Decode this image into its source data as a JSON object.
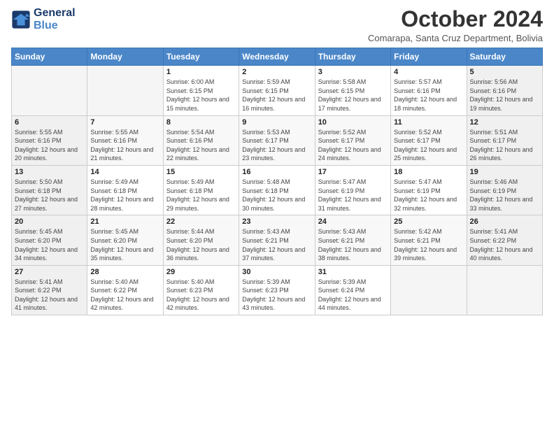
{
  "logo": {
    "line1": "General",
    "line2": "Blue"
  },
  "header": {
    "month": "October 2024",
    "subtitle": "Comarapa, Santa Cruz Department, Bolivia"
  },
  "weekdays": [
    "Sunday",
    "Monday",
    "Tuesday",
    "Wednesday",
    "Thursday",
    "Friday",
    "Saturday"
  ],
  "weeks": [
    [
      {
        "day": "",
        "info": ""
      },
      {
        "day": "",
        "info": ""
      },
      {
        "day": "1",
        "info": "Sunrise: 6:00 AM\nSunset: 6:15 PM\nDaylight: 12 hours and 15 minutes."
      },
      {
        "day": "2",
        "info": "Sunrise: 5:59 AM\nSunset: 6:15 PM\nDaylight: 12 hours and 16 minutes."
      },
      {
        "day": "3",
        "info": "Sunrise: 5:58 AM\nSunset: 6:15 PM\nDaylight: 12 hours and 17 minutes."
      },
      {
        "day": "4",
        "info": "Sunrise: 5:57 AM\nSunset: 6:16 PM\nDaylight: 12 hours and 18 minutes."
      },
      {
        "day": "5",
        "info": "Sunrise: 5:56 AM\nSunset: 6:16 PM\nDaylight: 12 hours and 19 minutes."
      }
    ],
    [
      {
        "day": "6",
        "info": "Sunrise: 5:55 AM\nSunset: 6:16 PM\nDaylight: 12 hours and 20 minutes."
      },
      {
        "day": "7",
        "info": "Sunrise: 5:55 AM\nSunset: 6:16 PM\nDaylight: 12 hours and 21 minutes."
      },
      {
        "day": "8",
        "info": "Sunrise: 5:54 AM\nSunset: 6:16 PM\nDaylight: 12 hours and 22 minutes."
      },
      {
        "day": "9",
        "info": "Sunrise: 5:53 AM\nSunset: 6:17 PM\nDaylight: 12 hours and 23 minutes."
      },
      {
        "day": "10",
        "info": "Sunrise: 5:52 AM\nSunset: 6:17 PM\nDaylight: 12 hours and 24 minutes."
      },
      {
        "day": "11",
        "info": "Sunrise: 5:52 AM\nSunset: 6:17 PM\nDaylight: 12 hours and 25 minutes."
      },
      {
        "day": "12",
        "info": "Sunrise: 5:51 AM\nSunset: 6:17 PM\nDaylight: 12 hours and 26 minutes."
      }
    ],
    [
      {
        "day": "13",
        "info": "Sunrise: 5:50 AM\nSunset: 6:18 PM\nDaylight: 12 hours and 27 minutes."
      },
      {
        "day": "14",
        "info": "Sunrise: 5:49 AM\nSunset: 6:18 PM\nDaylight: 12 hours and 28 minutes."
      },
      {
        "day": "15",
        "info": "Sunrise: 5:49 AM\nSunset: 6:18 PM\nDaylight: 12 hours and 29 minutes."
      },
      {
        "day": "16",
        "info": "Sunrise: 5:48 AM\nSunset: 6:18 PM\nDaylight: 12 hours and 30 minutes."
      },
      {
        "day": "17",
        "info": "Sunrise: 5:47 AM\nSunset: 6:19 PM\nDaylight: 12 hours and 31 minutes."
      },
      {
        "day": "18",
        "info": "Sunrise: 5:47 AM\nSunset: 6:19 PM\nDaylight: 12 hours and 32 minutes."
      },
      {
        "day": "19",
        "info": "Sunrise: 5:46 AM\nSunset: 6:19 PM\nDaylight: 12 hours and 33 minutes."
      }
    ],
    [
      {
        "day": "20",
        "info": "Sunrise: 5:45 AM\nSunset: 6:20 PM\nDaylight: 12 hours and 34 minutes."
      },
      {
        "day": "21",
        "info": "Sunrise: 5:45 AM\nSunset: 6:20 PM\nDaylight: 12 hours and 35 minutes."
      },
      {
        "day": "22",
        "info": "Sunrise: 5:44 AM\nSunset: 6:20 PM\nDaylight: 12 hours and 36 minutes."
      },
      {
        "day": "23",
        "info": "Sunrise: 5:43 AM\nSunset: 6:21 PM\nDaylight: 12 hours and 37 minutes."
      },
      {
        "day": "24",
        "info": "Sunrise: 5:43 AM\nSunset: 6:21 PM\nDaylight: 12 hours and 38 minutes."
      },
      {
        "day": "25",
        "info": "Sunrise: 5:42 AM\nSunset: 6:21 PM\nDaylight: 12 hours and 39 minutes."
      },
      {
        "day": "26",
        "info": "Sunrise: 5:41 AM\nSunset: 6:22 PM\nDaylight: 12 hours and 40 minutes."
      }
    ],
    [
      {
        "day": "27",
        "info": "Sunrise: 5:41 AM\nSunset: 6:22 PM\nDaylight: 12 hours and 41 minutes."
      },
      {
        "day": "28",
        "info": "Sunrise: 5:40 AM\nSunset: 6:22 PM\nDaylight: 12 hours and 42 minutes."
      },
      {
        "day": "29",
        "info": "Sunrise: 5:40 AM\nSunset: 6:23 PM\nDaylight: 12 hours and 42 minutes."
      },
      {
        "day": "30",
        "info": "Sunrise: 5:39 AM\nSunset: 6:23 PM\nDaylight: 12 hours and 43 minutes."
      },
      {
        "day": "31",
        "info": "Sunrise: 5:39 AM\nSunset: 6:24 PM\nDaylight: 12 hours and 44 minutes."
      },
      {
        "day": "",
        "info": ""
      },
      {
        "day": "",
        "info": ""
      }
    ]
  ]
}
